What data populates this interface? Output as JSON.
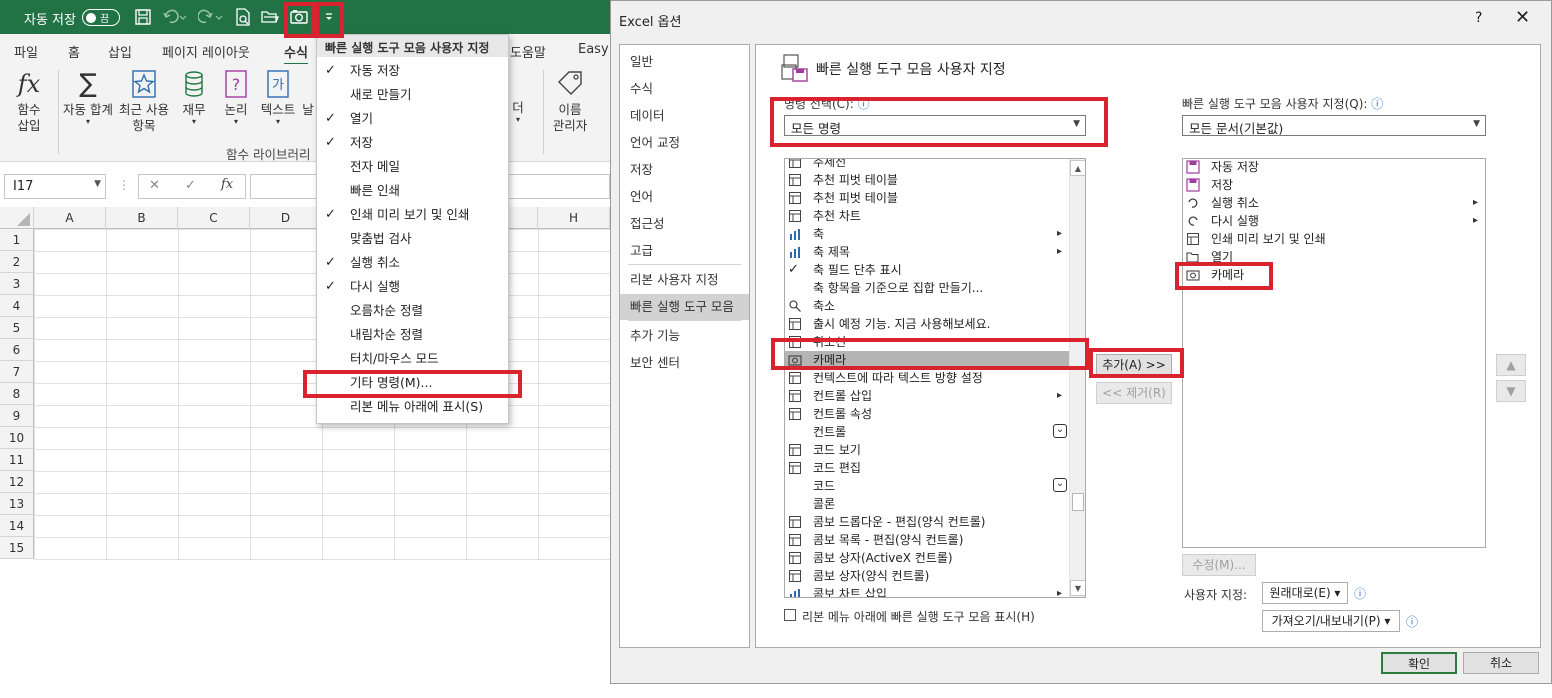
{
  "excel": {
    "autosave_label": "자동 저장",
    "autosave_state": "끔",
    "tabs": [
      "파일",
      "홈",
      "삽입",
      "페이지 레이아웃",
      "수식",
      "도움말",
      "Easy"
    ],
    "active_tab": "수식",
    "ribbon": {
      "insert_function": "함수\n삽입",
      "buttons": [
        "자동 합계",
        "최근 사용\n항목",
        "재무",
        "논리",
        "텍스트",
        "날"
      ],
      "group_label": "함수 라이브러리",
      "name_manager": "이름\n관리자",
      "more": "더"
    },
    "name_box": "I17",
    "formula_symbols": {
      "cancel": "✕",
      "enter": "✓",
      "fx": "fx"
    },
    "columns": [
      "A",
      "B",
      "C",
      "D",
      "H"
    ],
    "rows": [
      "1",
      "2",
      "3",
      "4",
      "5",
      "6",
      "7",
      "8",
      "9",
      "10",
      "11",
      "12",
      "13",
      "14",
      "15"
    ]
  },
  "qat_menu": {
    "title": "빠른 실행 도구 모음 사용자 지정",
    "items": [
      {
        "label": "자동 저장",
        "checked": true
      },
      {
        "label": "새로 만들기",
        "checked": false
      },
      {
        "label": "열기",
        "checked": true
      },
      {
        "label": "저장",
        "checked": true
      },
      {
        "label": "전자 메일",
        "checked": false
      },
      {
        "label": "빠른 인쇄",
        "checked": false
      },
      {
        "label": "인쇄 미리 보기 및 인쇄",
        "checked": true
      },
      {
        "label": "맞춤법 검사",
        "checked": false
      },
      {
        "label": "실행 취소",
        "checked": true
      },
      {
        "label": "다시 실행",
        "checked": true
      },
      {
        "label": "오름차순 정렬",
        "checked": false
      },
      {
        "label": "내림차순 정렬",
        "checked": false
      },
      {
        "label": "터치/마우스 모드",
        "checked": false
      },
      {
        "label": "기타 명령(M)...",
        "checked": false
      },
      {
        "label": "리본 메뉴 아래에 표시(S)",
        "checked": false
      }
    ],
    "check_glyph": "✓"
  },
  "dialog": {
    "title": "Excel 옵션",
    "help": "?",
    "close": "✕",
    "nav": [
      "일반",
      "수식",
      "데이터",
      "언어 교정",
      "저장",
      "언어",
      "접근성",
      "고급",
      "리본 사용자 지정",
      "빠른 실행 도구 모음",
      "추가 기능",
      "보안 센터"
    ],
    "nav_selected": "빠른 실행 도구 모음",
    "section_title": "빠른 실행 도구 모음 사용자 지정",
    "choose_label": "명령 선택(C):",
    "choose_value": "모든 명령",
    "customize_label": "빠른 실행 도구 모음 사용자 지정(Q):",
    "customize_value": "모든 문서(기본값)",
    "commands": [
      {
        "label": "추세선",
        "sub": ""
      },
      {
        "label": "추천 피벗 테이블",
        "sub": ""
      },
      {
        "label": "추천 피벗 테이블",
        "sub": ""
      },
      {
        "label": "추천 차트",
        "sub": ""
      },
      {
        "label": "축",
        "sub": "▸"
      },
      {
        "label": "축 제목",
        "sub": "▸"
      },
      {
        "label": "축 필드 단추 표시",
        "sub": ""
      },
      {
        "label": "축 항목을 기준으로 집합 만들기...",
        "sub": ""
      },
      {
        "label": "축소",
        "sub": ""
      },
      {
        "label": "출시 예정 기능. 지금 사용해보세요.",
        "sub": ""
      },
      {
        "label": "취소선",
        "sub": ""
      },
      {
        "label": "카메라",
        "sub": ""
      },
      {
        "label": "컨텍스트에 따라 텍스트 방향 설정",
        "sub": ""
      },
      {
        "label": "컨트롤 삽입",
        "sub": "▸"
      },
      {
        "label": "컨트롤 속성",
        "sub": ""
      },
      {
        "label": "컨트롤",
        "sub": "⌄"
      },
      {
        "label": "코드 보기",
        "sub": ""
      },
      {
        "label": "코드 편집",
        "sub": ""
      },
      {
        "label": "코드",
        "sub": "⌄"
      },
      {
        "label": "콜론",
        "sub": ""
      },
      {
        "label": "콤보 드롭다운 - 편집(양식 컨트롤)",
        "sub": ""
      },
      {
        "label": "콤보 목록 - 편집(양식 컨트롤)",
        "sub": ""
      },
      {
        "label": "콤보 상자(ActiveX 컨트롤)",
        "sub": ""
      },
      {
        "label": "콤보 상자(양식 컨트롤)",
        "sub": ""
      },
      {
        "label": "콤보 차트 삽입",
        "sub": "▸"
      }
    ],
    "selected_command": "카메라",
    "qat_list": [
      {
        "label": "자동 저장",
        "sub": ""
      },
      {
        "label": "저장",
        "sub": ""
      },
      {
        "label": "실행 취소",
        "sub": "▸"
      },
      {
        "label": "다시 실행",
        "sub": "▸"
      },
      {
        "label": "인쇄 미리 보기 및 인쇄",
        "sub": ""
      },
      {
        "label": "열기",
        "sub": ""
      },
      {
        "label": "카메라",
        "sub": ""
      }
    ],
    "add_button": "추가(A) >>",
    "remove_button": "<< 제거(R)",
    "modify_button": "수정(M)...",
    "user_label": "사용자 지정:",
    "reset_button": "원래대로(E) ▾",
    "import_export_button": "가져오기/내보내기(P) ▾",
    "show_below_label": "리본 메뉴 아래에 빠른 실행 도구 모음 표시(H)",
    "ok": "확인",
    "cancel": "취소",
    "info_glyph": "ⓘ"
  },
  "colors": {
    "excel_green": "#217346",
    "highlight_red": "#d9232e",
    "list_selection": "#b4b4b4"
  }
}
